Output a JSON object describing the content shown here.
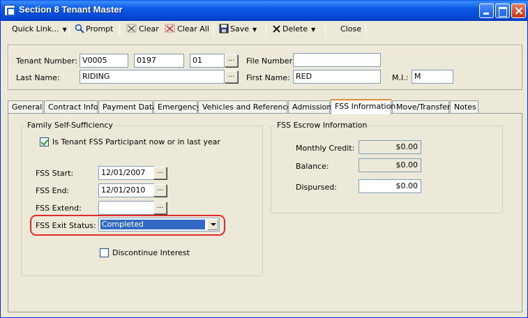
{
  "window": {
    "title": "Section 8 Tenant Master",
    "title_icon": "app-icon"
  },
  "toolbar": {
    "quick_link": "Quick Link...",
    "prompt": "Prompt",
    "clear": "Clear",
    "clear_all": "Clear All",
    "save": "Save",
    "delete": "Delete",
    "close": "Close"
  },
  "header": {
    "tenant_number_label": "Tenant Number:",
    "tenant_number_1": "V0005",
    "tenant_number_2": "0197",
    "tenant_number_3": "01",
    "file_number_label": "File Number:",
    "file_number": "",
    "last_name_label": "Last Name:",
    "last_name": "RIDING",
    "first_name_label": "First Name:",
    "first_name": "RED",
    "mi_label": "M.I.:",
    "mi": "M",
    "ellipsis": "..."
  },
  "tabs": [
    {
      "label": "General"
    },
    {
      "label": "Contract Info"
    },
    {
      "label": "Payment Data"
    },
    {
      "label": "Emergency"
    },
    {
      "label": "Vehicles and References"
    },
    {
      "label": "Admission"
    },
    {
      "label": "FSS Information",
      "active": true
    },
    {
      "label": "Move/Transfer"
    },
    {
      "label": "Notes"
    }
  ],
  "fss": {
    "group_title": "Family Self-Sufficiency",
    "participant_label": "Is Tenant FSS Participant now or in last year",
    "participant_checked": true,
    "start_label": "FSS Start:",
    "start": "12/01/2007",
    "end_label": "FSS End:",
    "end": "12/01/2010",
    "extend_label": "FSS Extend:",
    "extend": "",
    "exit_status_label": "FSS Exit Status:",
    "exit_status": "Completed",
    "discontinue_label": "Discontinue Interest",
    "discontinue_checked": false
  },
  "escrow": {
    "group_title": "FSS Escrow Information",
    "monthly_credit_label": "Monthly Credit:",
    "monthly_credit": "$0.00",
    "balance_label": "Balance:",
    "balance": "$0.00",
    "dispursed_label": "Dispursed:",
    "dispursed": "$0.00"
  },
  "colors": {
    "highlight": "#e32a2a",
    "active_tab_accent": "#e68b2c",
    "selection": "#316ac5"
  }
}
